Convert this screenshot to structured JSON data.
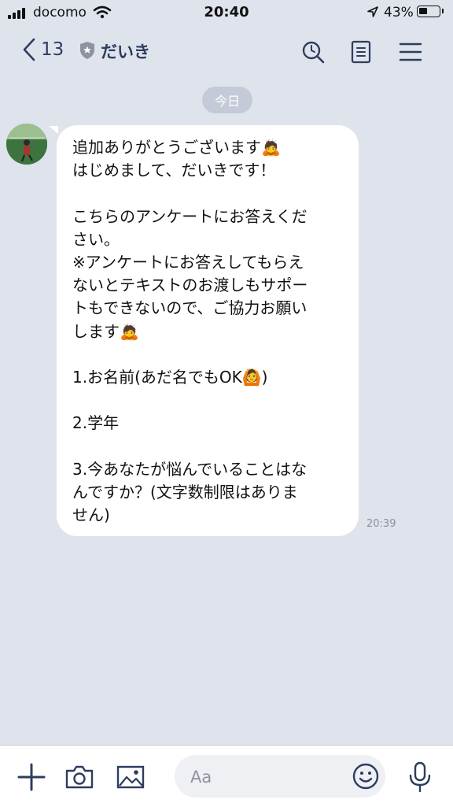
{
  "status_bar": {
    "carrier": "docomo",
    "time": "20:40",
    "battery_percent_text": "43%",
    "battery_level": 0.43
  },
  "header": {
    "back_count": "13",
    "chat_name": "だいき"
  },
  "chat": {
    "date_label": "今日",
    "messages": [
      {
        "text": "追加ありがとうございます🙇\nはじめまして、だいきです！\n\nこちらのアンケートにお答えくだ\nさい。\n※アンケートにお答えしてもらえ\nないとテキストのお渡しもサポー\nトもできないので、ご協力お願い\nします🙇\n\n1.お名前(あだ名でもOK🙆)\n\n2.学年\n\n3.今あなたが悩んでいることはな\nんですか？(文字数制限はありま\nせん)",
        "time": "20:39"
      }
    ]
  },
  "input_bar": {
    "placeholder": "Aa"
  },
  "colors": {
    "background": "#dfe3ec",
    "header_text": "#2d3d5f",
    "bubble": "#ffffff",
    "date_chip": "#c4cad8"
  }
}
